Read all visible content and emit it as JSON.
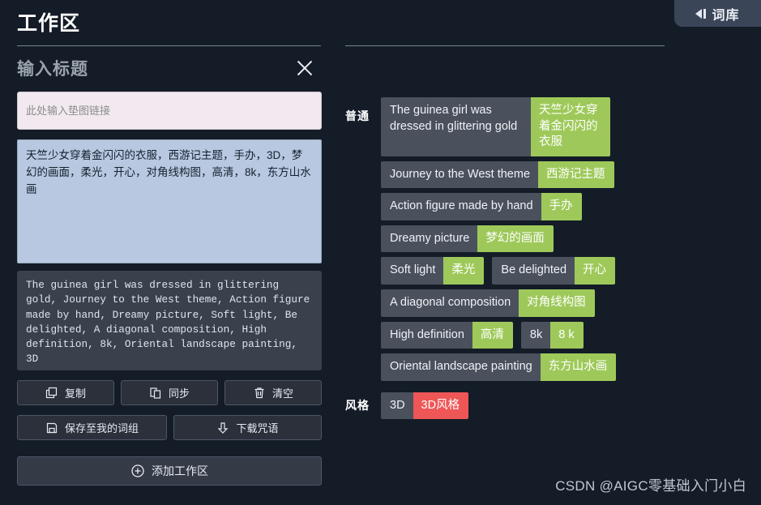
{
  "drawer": {
    "label": "词库",
    "icon": "collapse-left-icon"
  },
  "left": {
    "workspace_title": "工作区",
    "input_title_placeholder": "输入标题",
    "close_icon": "close-icon",
    "link_input": {
      "value": "",
      "placeholder": "此处输入垫图链接"
    },
    "cn_prompt": "天竺少女穿着金闪闪的衣服，西游记主题，手办，3D，梦幻的画面，柔光，开心，对角线构图，高清，8k，东方山水画",
    "en_prompt": "The guinea girl was dressed in glittering gold, Journey to the West theme, Action figure made by hand, Dreamy picture, Soft light, Be delighted, A diagonal composition, High definition, 8k, Oriental landscape painting, 3D",
    "buttons": {
      "copy": {
        "label": "复制",
        "icon": "copy-icon"
      },
      "sync": {
        "label": "同步",
        "icon": "sync-copy-icon"
      },
      "clear": {
        "label": "清空",
        "icon": "trash-icon"
      },
      "save_group": {
        "label": "保存至我的词组",
        "icon": "floppy-save-icon"
      },
      "download": {
        "label": "下载咒语",
        "icon": "download-arrow-icon"
      },
      "add_workspace": {
        "label": "添加工作区",
        "icon": "plus-circle-icon"
      }
    }
  },
  "right": {
    "groups": [
      {
        "label": "普通",
        "rows": [
          [
            {
              "en": "The guinea girl was dressed in glittering gold",
              "cn": "天竺少女穿着金闪闪的衣服",
              "multiline": true,
              "highlight": "green"
            }
          ],
          [
            {
              "en": "Journey to the West theme",
              "cn": "西游记主题",
              "highlight": "green"
            }
          ],
          [
            {
              "en": "Action figure made by hand",
              "cn": "手办",
              "highlight": "green"
            }
          ],
          [
            {
              "en": "Dreamy picture",
              "cn": "梦幻的画面",
              "highlight": "green"
            }
          ],
          [
            {
              "en": "Soft light",
              "cn": "柔光",
              "highlight": "green"
            },
            {
              "en": "Be delighted",
              "cn": "开心",
              "highlight": "green"
            }
          ],
          [
            {
              "en": "A diagonal composition",
              "cn": "对角线构图",
              "highlight": "green"
            }
          ],
          [
            {
              "en": "High definition",
              "cn": "高清",
              "highlight": "green"
            },
            {
              "en": "8k",
              "cn": "8 k",
              "highlight": "green"
            }
          ],
          [
            {
              "en": "Oriental landscape painting",
              "cn": "东方山水画",
              "highlight": "green"
            }
          ]
        ]
      },
      {
        "label": "风格",
        "rows": [
          [
            {
              "en": "3D",
              "cn": "3D风格",
              "highlight": "red"
            }
          ]
        ]
      }
    ]
  },
  "watermark": "CSDN @AIGC零基础入门小白",
  "colors": {
    "background": "#141c28",
    "chip_en_bg": "#4a515d",
    "chip_cn_green": "#9ec95a",
    "chip_cn_red": "#ef5656",
    "link_input_bg": "#f1e9ef",
    "cn_textarea_bg": "#b7c8e0",
    "en_output_bg": "#3a414c",
    "drawer_tab_bg": "#3b4558"
  }
}
